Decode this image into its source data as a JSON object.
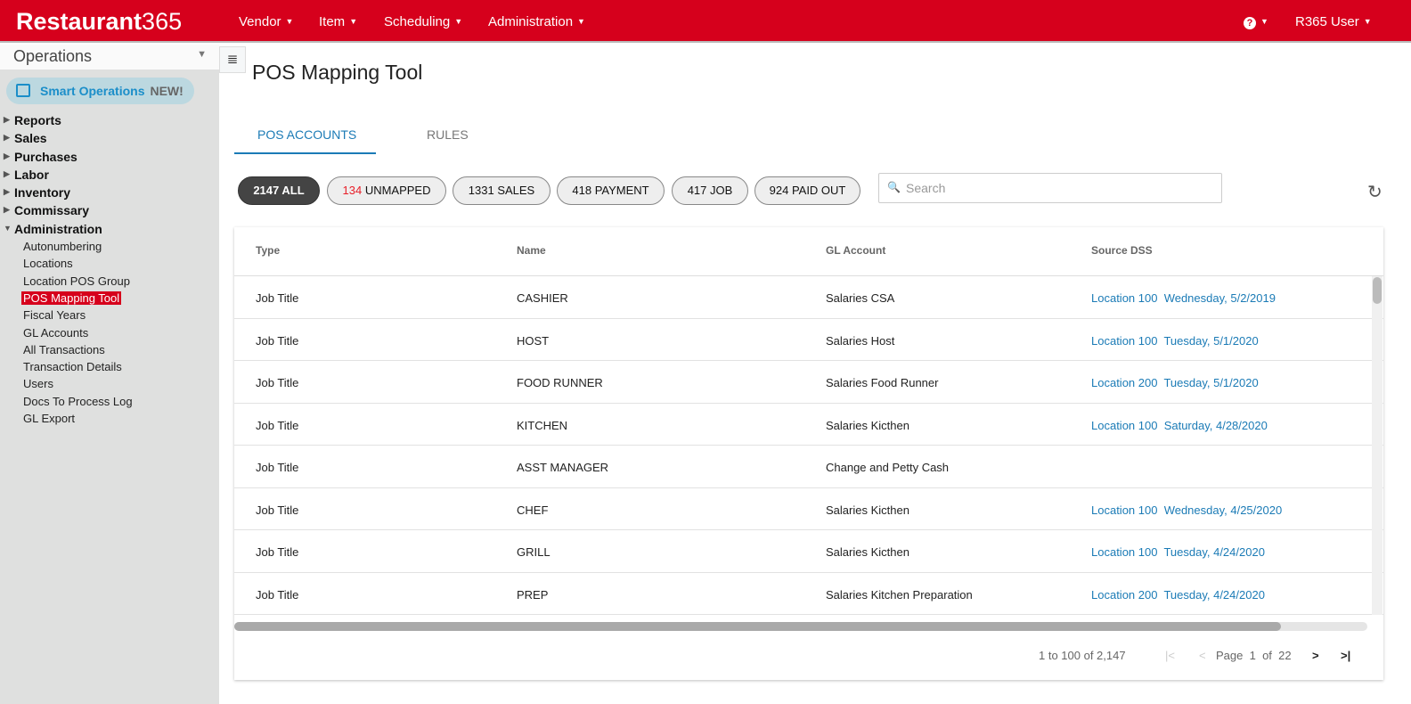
{
  "topbar": {
    "logo_bold": "Restaurant",
    "logo_light": "365",
    "nav": [
      "Vendor",
      "Item",
      "Scheduling",
      "Administration"
    ],
    "help_icon": "question-circle",
    "user": "R365 User"
  },
  "sidebar": {
    "selector": "Operations",
    "smart": "Smart Operations",
    "smart_badge": "NEW!",
    "sections": [
      "Reports",
      "Sales",
      "Purchases",
      "Labor",
      "Inventory",
      "Commissary",
      "Administration"
    ],
    "admin_items": [
      "Autonumbering",
      "Locations",
      "Location POS Group",
      "POS Mapping Tool",
      "Fiscal Years",
      "GL Accounts",
      "All Transactions",
      "Transaction Details",
      "Users",
      "Docs To Process Log",
      "GL Export"
    ],
    "selected": "POS Mapping Tool"
  },
  "page": {
    "title": "POS Mapping Tool",
    "tabs": [
      "POS ACCOUNTS",
      "RULES"
    ],
    "active_tab": "POS ACCOUNTS"
  },
  "filters": [
    {
      "count": "2147",
      "label": "ALL"
    },
    {
      "count": "134",
      "label": "UNMAPPED"
    },
    {
      "count": "1331",
      "label": "SALES"
    },
    {
      "count": "418",
      "label": "PAYMENT"
    },
    {
      "count": "417",
      "label": "JOB"
    },
    {
      "count": "924",
      "label": "PAID OUT"
    }
  ],
  "search": {
    "placeholder": "Search"
  },
  "colors": {
    "brand": "#d6001c",
    "link": "#1b7bb6",
    "unmapped_count": "#e8202a"
  },
  "table": {
    "columns": [
      "Type",
      "Name",
      "GL Account",
      "Source DSS"
    ],
    "rows": [
      [
        "Job Title",
        "CASHIER",
        "Salaries CSA",
        "Location 100",
        "Wednesday, 5/2/2019"
      ],
      [
        "Job Title",
        "HOST",
        "Salaries Host",
        "Location 100",
        "Tuesday, 5/1/2020"
      ],
      [
        "Job Title",
        "FOOD RUNNER",
        "Salaries Food Runner",
        "Location 200",
        "Tuesday, 5/1/2020"
      ],
      [
        "Job Title",
        "KITCHEN",
        "Salaries Kicthen",
        "Location 100",
        "Saturday, 4/28/2020"
      ],
      [
        "Job Title",
        "ASST MANAGER",
        "Change and Petty Cash",
        "",
        ""
      ],
      [
        "Job Title",
        "CHEF",
        "Salaries Kicthen",
        "Location 100",
        "Wednesday, 4/25/2020"
      ],
      [
        "Job Title",
        "GRILL",
        "Salaries Kicthen",
        "Location 100",
        "Tuesday, 4/24/2020"
      ],
      [
        "Job Title",
        "PREP",
        "Salaries Kitchen Preparation",
        "Location 200",
        "Tuesday, 4/24/2020"
      ]
    ]
  },
  "pager": {
    "range": "1 to 100 of 2,147",
    "page_label": "Page",
    "page": "1",
    "of": "of",
    "total": "22"
  }
}
